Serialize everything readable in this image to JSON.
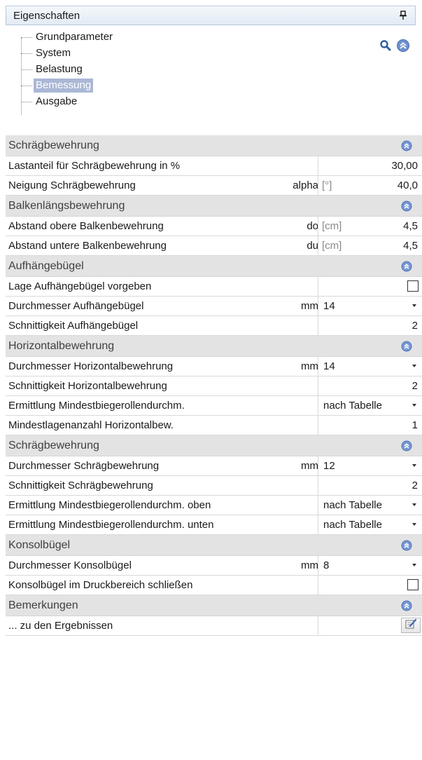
{
  "panel": {
    "title": "Eigenschaften"
  },
  "tree": {
    "items": [
      {
        "label": "Grundparameter",
        "selected": false
      },
      {
        "label": "System",
        "selected": false
      },
      {
        "label": "Belastung",
        "selected": false
      },
      {
        "label": "Bemessung",
        "selected": true
      },
      {
        "label": "Ausgabe",
        "selected": false
      }
    ]
  },
  "icons": {
    "pin": "pin-icon",
    "search": "search-icon",
    "collapse_all": "double-chevron-up-icon",
    "category_toggle": "double-chevron-up-icon",
    "edit": "edit-note-icon"
  },
  "colors": {
    "category_bg": "#e3e3e3",
    "toggle_blue": "#5b7fc0",
    "selection_bg": "#aab8d6"
  },
  "sections": [
    {
      "title": "Schrägbewehrung",
      "rows": [
        {
          "name": "Lastanteil für Schrägbewehrung in %",
          "symbol": "",
          "unit": "",
          "value": "30,00",
          "type": "text"
        },
        {
          "name": "Neigung Schrägbewehrung",
          "symbol": "alpha",
          "unit": "[°]",
          "value": "40,0",
          "type": "text"
        }
      ]
    },
    {
      "title": "Balkenlängsbewehrung",
      "rows": [
        {
          "name": "Abstand obere Balkenbewehrung",
          "symbol": "do",
          "unit": "[cm]",
          "value": "4,5",
          "type": "text"
        },
        {
          "name": "Abstand untere Balkenbewehrung",
          "symbol": "du",
          "unit": "[cm]",
          "value": "4,5",
          "type": "text"
        }
      ]
    },
    {
      "title": "Aufhängebügel",
      "rows": [
        {
          "name": "Lage Aufhängebügel vorgeben",
          "symbol": "",
          "unit": "",
          "value": "",
          "type": "checkbox"
        },
        {
          "name": "Durchmesser Aufhängebügel",
          "symbol": "mm",
          "unit": "",
          "value": "14",
          "type": "combo"
        },
        {
          "name": "Schnittigkeit Aufhängebügel",
          "symbol": "",
          "unit": "",
          "value": "2",
          "type": "text"
        }
      ]
    },
    {
      "title": "Horizontalbewehrung",
      "rows": [
        {
          "name": "Durchmesser Horizontalbewehrung",
          "symbol": "mm",
          "unit": "",
          "value": "14",
          "type": "combo"
        },
        {
          "name": "Schnittigkeit Horizontalbewehrung",
          "symbol": "",
          "unit": "",
          "value": "2",
          "type": "text"
        },
        {
          "name": "Ermittlung Mindestbiegerollendurchm.",
          "symbol": "",
          "unit": "",
          "value": "nach Tabelle",
          "type": "combo"
        },
        {
          "name": "Mindestlagenanzahl Horizontalbew.",
          "symbol": "",
          "unit": "",
          "value": "1",
          "type": "text"
        }
      ]
    },
    {
      "title": "Schrägbewehrung",
      "rows": [
        {
          "name": "Durchmesser Schrägbewehrung",
          "symbol": "mm",
          "unit": "",
          "value": "12",
          "type": "combo"
        },
        {
          "name": "Schnittigkeit Schrägbewehrung",
          "symbol": "",
          "unit": "",
          "value": "2",
          "type": "text"
        },
        {
          "name": "Ermittlung Mindestbiegerollendurchm. oben",
          "symbol": "",
          "unit": "",
          "value": "nach Tabelle",
          "type": "combo"
        },
        {
          "name": "Ermittlung Mindestbiegerollendurchm. unten",
          "symbol": "",
          "unit": "",
          "value": "nach Tabelle",
          "type": "combo"
        }
      ]
    },
    {
      "title": "Konsolbügel",
      "rows": [
        {
          "name": "Durchmesser Konsolbügel",
          "symbol": "mm",
          "unit": "",
          "value": "8",
          "type": "combo"
        },
        {
          "name": "Konsolbügel im Druckbereich schließen",
          "symbol": "",
          "unit": "",
          "value": "",
          "type": "checkbox"
        }
      ]
    },
    {
      "title": "Bemerkungen",
      "rows": [
        {
          "name": "... zu den Ergebnissen",
          "symbol": "",
          "unit": "",
          "value": "",
          "type": "edit"
        }
      ]
    }
  ]
}
